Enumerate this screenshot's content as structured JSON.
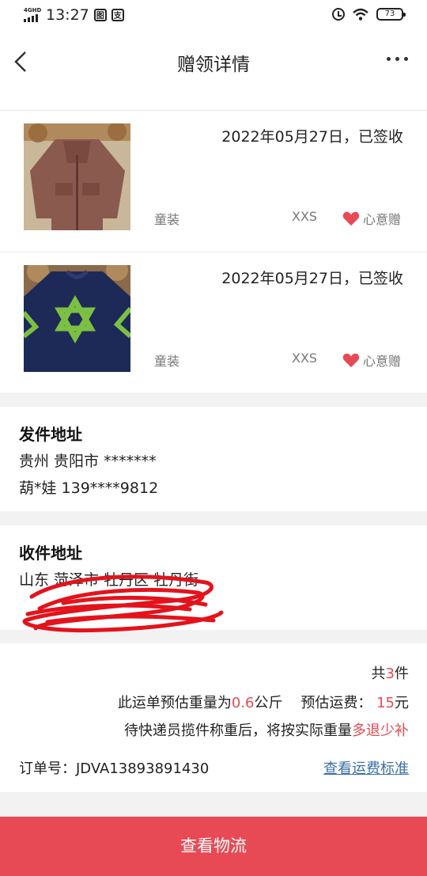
{
  "status_bar": {
    "network": "4GHD",
    "time": "13:27",
    "battery": "73"
  },
  "header": {
    "title": "赠领详情"
  },
  "items": [
    {
      "date_status": "2022年05月27日，已签收",
      "category": "童装",
      "size": "XXS",
      "tag": "心意赠"
    },
    {
      "date_status": "2022年05月27日，已签收",
      "category": "童装",
      "size": "XXS",
      "tag": "心意赠"
    }
  ],
  "sender": {
    "title": "发件地址",
    "address": "贵州 贵阳市 *******",
    "contact": "葫*娃 139****9812"
  },
  "receiver": {
    "title": "收件地址",
    "address": "山东 菏泽市 牡丹区 牡丹街"
  },
  "summary": {
    "count_prefix": "共",
    "count": "3",
    "count_suffix": "件",
    "weight_prefix": "此运单预估重量为",
    "weight": "0.6",
    "weight_unit": "公斤",
    "fee_label": "预估运费：",
    "fee": "15",
    "fee_unit": "元",
    "note_prefix": "待快递员揽件称重后，将按实际重量",
    "note_highlight": "多退少补",
    "order_label": "订单号：JDVA13893891430",
    "fee_standard_link": "查看运费标准"
  },
  "logistics_button": "查看物流",
  "colors": {
    "accent_red": "#e84a55",
    "link_blue": "#3a6fa8",
    "heart": "#e84a55"
  }
}
